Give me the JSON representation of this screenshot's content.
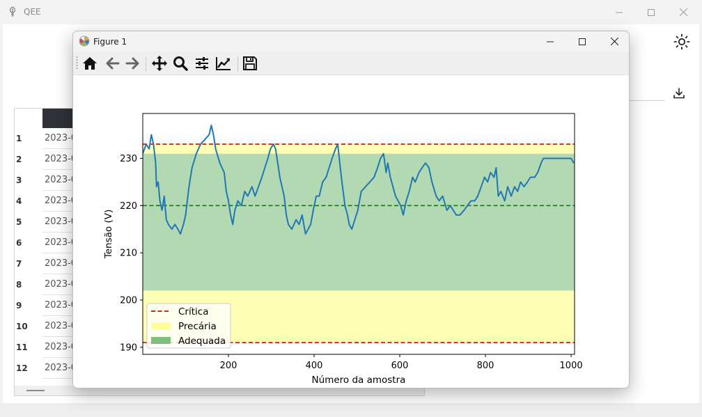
{
  "app": {
    "title": "QEE",
    "icons": {
      "app": "leaf-plug-icon",
      "theme": "sun-icon",
      "download": "download-icon"
    }
  },
  "table": {
    "rows": [
      {
        "index": "1",
        "value": "2023-0"
      },
      {
        "index": "2",
        "value": "2023-0"
      },
      {
        "index": "3",
        "value": "2023-0"
      },
      {
        "index": "4",
        "value": "2023-0"
      },
      {
        "index": "5",
        "value": "2023-0"
      },
      {
        "index": "6",
        "value": "2023-0"
      },
      {
        "index": "7",
        "value": "2023-0"
      },
      {
        "index": "8",
        "value": "2023-0"
      },
      {
        "index": "9",
        "value": "2023-0"
      },
      {
        "index": "10",
        "value": "2023-0"
      },
      {
        "index": "11",
        "value": "2023-0"
      },
      {
        "index": "12",
        "value": "2023-0"
      }
    ],
    "header_color": "#2f3237"
  },
  "figure": {
    "title": "Figure 1",
    "toolbar": [
      "home-icon",
      "back-arrow-icon",
      "forward-arrow-icon",
      "pan-move-icon",
      "zoom-magnifier-icon",
      "configure-subplots-icon",
      "edit-axis-icon",
      "save-floppy-icon"
    ]
  },
  "chart_data": {
    "type": "line",
    "xlabel": "Número da amostra",
    "ylabel": "Tensão (V)",
    "xlim": [
      0,
      1008
    ],
    "ylim": [
      188.5,
      239.5
    ],
    "xticks": [
      200,
      400,
      600,
      800,
      1000
    ],
    "yticks": [
      190,
      200,
      210,
      220,
      230
    ],
    "grid": false,
    "legend_position": "lower-left",
    "legend": [
      {
        "label": "Crítica",
        "kind": "dashed-line",
        "color": "#dd0000"
      },
      {
        "label": "Precária",
        "kind": "patch",
        "color": "#ffff99"
      },
      {
        "label": "Adequada",
        "kind": "patch",
        "color": "#7ebf7e"
      }
    ],
    "bands": [
      {
        "name": "Precária",
        "y0": 191,
        "y1": 202,
        "color": "#ffffb3"
      },
      {
        "name": "Adequada",
        "y0": 202,
        "y1": 231,
        "color": "#b3d9b3"
      },
      {
        "name": "Precária",
        "y0": 231,
        "y1": 233,
        "color": "#ffffb3"
      }
    ],
    "hlines": [
      {
        "y": 233,
        "color": "#dd0000",
        "dash": true
      },
      {
        "y": 191,
        "color": "#dd0000",
        "dash": true
      },
      {
        "y": 220,
        "color": "#008800",
        "dash": true
      }
    ],
    "series": [
      {
        "color": "#1f77b4",
        "points": [
          [
            0,
            231
          ],
          [
            8,
            233
          ],
          [
            15,
            232
          ],
          [
            20,
            235
          ],
          [
            25,
            233
          ],
          [
            30,
            229
          ],
          [
            32,
            224
          ],
          [
            36,
            225
          ],
          [
            40,
            221
          ],
          [
            45,
            219
          ],
          [
            50,
            222
          ],
          [
            55,
            217
          ],
          [
            60,
            216
          ],
          [
            68,
            215
          ],
          [
            75,
            216
          ],
          [
            82,
            215
          ],
          [
            88,
            214
          ],
          [
            95,
            216
          ],
          [
            100,
            218
          ],
          [
            108,
            224
          ],
          [
            115,
            228
          ],
          [
            125,
            231
          ],
          [
            135,
            233
          ],
          [
            145,
            234
          ],
          [
            155,
            235
          ],
          [
            160,
            237
          ],
          [
            165,
            235
          ],
          [
            170,
            232
          ],
          [
            180,
            229
          ],
          [
            190,
            227
          ],
          [
            195,
            223
          ],
          [
            200,
            221
          ],
          [
            205,
            218
          ],
          [
            210,
            216
          ],
          [
            215,
            219
          ],
          [
            222,
            221
          ],
          [
            230,
            220
          ],
          [
            238,
            223
          ],
          [
            245,
            222
          ],
          [
            255,
            224
          ],
          [
            262,
            222
          ],
          [
            270,
            224
          ],
          [
            278,
            226
          ],
          [
            285,
            228
          ],
          [
            292,
            230
          ],
          [
            298,
            232
          ],
          [
            305,
            233
          ],
          [
            310,
            232
          ],
          [
            315,
            229
          ],
          [
            320,
            226
          ],
          [
            325,
            224
          ],
          [
            330,
            222
          ],
          [
            335,
            218
          ],
          [
            340,
            216
          ],
          [
            348,
            215
          ],
          [
            358,
            217
          ],
          [
            365,
            216
          ],
          [
            372,
            218
          ],
          [
            380,
            214
          ],
          [
            386,
            215
          ],
          [
            392,
            216
          ],
          [
            398,
            219
          ],
          [
            405,
            222
          ],
          [
            412,
            222
          ],
          [
            420,
            225
          ],
          [
            428,
            226
          ],
          [
            435,
            228
          ],
          [
            442,
            230
          ],
          [
            450,
            232
          ],
          [
            455,
            233
          ],
          [
            460,
            229
          ],
          [
            465,
            225
          ],
          [
            472,
            220
          ],
          [
            478,
            218
          ],
          [
            482,
            216
          ],
          [
            488,
            215
          ],
          [
            495,
            217
          ],
          [
            502,
            219
          ],
          [
            510,
            223
          ],
          [
            520,
            224
          ],
          [
            530,
            225
          ],
          [
            540,
            226
          ],
          [
            548,
            228
          ],
          [
            555,
            230
          ],
          [
            562,
            231
          ],
          [
            568,
            227
          ],
          [
            572,
            229
          ],
          [
            578,
            226
          ],
          [
            584,
            224
          ],
          [
            590,
            222
          ],
          [
            596,
            221
          ],
          [
            602,
            220
          ],
          [
            608,
            218
          ],
          [
            615,
            221
          ],
          [
            622,
            223
          ],
          [
            630,
            226
          ],
          [
            636,
            225
          ],
          [
            645,
            227
          ],
          [
            652,
            228
          ],
          [
            660,
            229
          ],
          [
            668,
            228
          ],
          [
            675,
            225
          ],
          [
            685,
            222
          ],
          [
            692,
            221
          ],
          [
            700,
            222
          ],
          [
            710,
            219
          ],
          [
            718,
            220
          ],
          [
            725,
            219
          ],
          [
            732,
            218
          ],
          [
            740,
            218
          ],
          [
            750,
            219
          ],
          [
            758,
            220
          ],
          [
            766,
            221
          ],
          [
            775,
            221
          ],
          [
            782,
            222
          ],
          [
            790,
            224
          ],
          [
            798,
            226
          ],
          [
            805,
            225
          ],
          [
            812,
            227
          ],
          [
            820,
            226
          ],
          [
            825,
            228
          ],
          [
            830,
            222
          ],
          [
            836,
            223
          ],
          [
            845,
            221
          ],
          [
            852,
            224
          ],
          [
            860,
            222
          ],
          [
            868,
            224
          ],
          [
            875,
            223
          ],
          [
            882,
            225
          ],
          [
            890,
            224
          ],
          [
            898,
            225
          ],
          [
            905,
            226
          ],
          [
            915,
            226
          ],
          [
            922,
            227
          ],
          [
            930,
            229
          ],
          [
            935,
            230
          ],
          [
            1000,
            230
          ],
          [
            1006,
            229
          ]
        ]
      }
    ]
  }
}
